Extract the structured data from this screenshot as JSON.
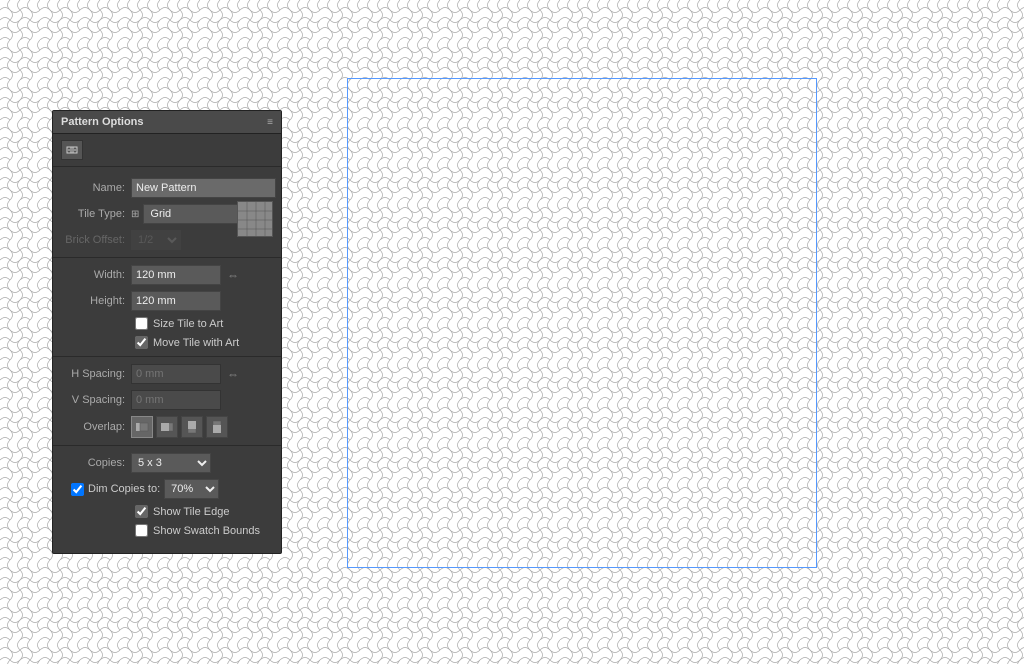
{
  "background": {
    "color": "#e0e0e0",
    "wave_color": "#b0b0b0"
  },
  "panel": {
    "title": "Pattern Options",
    "menu_icon": "≡",
    "icon_btn_label": "⇔",
    "name_label": "Name:",
    "name_value": "New Pattern",
    "tile_type_label": "Tile Type:",
    "tile_type_value": "Grid",
    "tile_type_icon": "⊞",
    "brick_offset_label": "Brick Offset:",
    "brick_offset_value": "1/2",
    "width_label": "Width:",
    "width_value": "120 mm",
    "height_label": "Height:",
    "height_value": "120 mm",
    "size_tile_label": "Size Tile to Art",
    "move_tile_label": "Move Tile with Art",
    "size_tile_checked": false,
    "move_tile_checked": true,
    "h_spacing_label": "H Spacing:",
    "h_spacing_value": "0 mm",
    "v_spacing_label": "V Spacing:",
    "v_spacing_value": "0 mm",
    "overlap_label": "Overlap:",
    "copies_label": "Copies:",
    "copies_value": "5 x 3",
    "dim_copies_label": "Dim Copies to:",
    "dim_copies_value": "70%",
    "show_tile_edge_label": "Show Tile Edge",
    "show_tile_edge_checked": true,
    "show_swatch_bounds_label": "Show Swatch Bounds",
    "show_swatch_bounds_checked": false
  },
  "blue_rect": {
    "border_color": "#5599ff"
  }
}
